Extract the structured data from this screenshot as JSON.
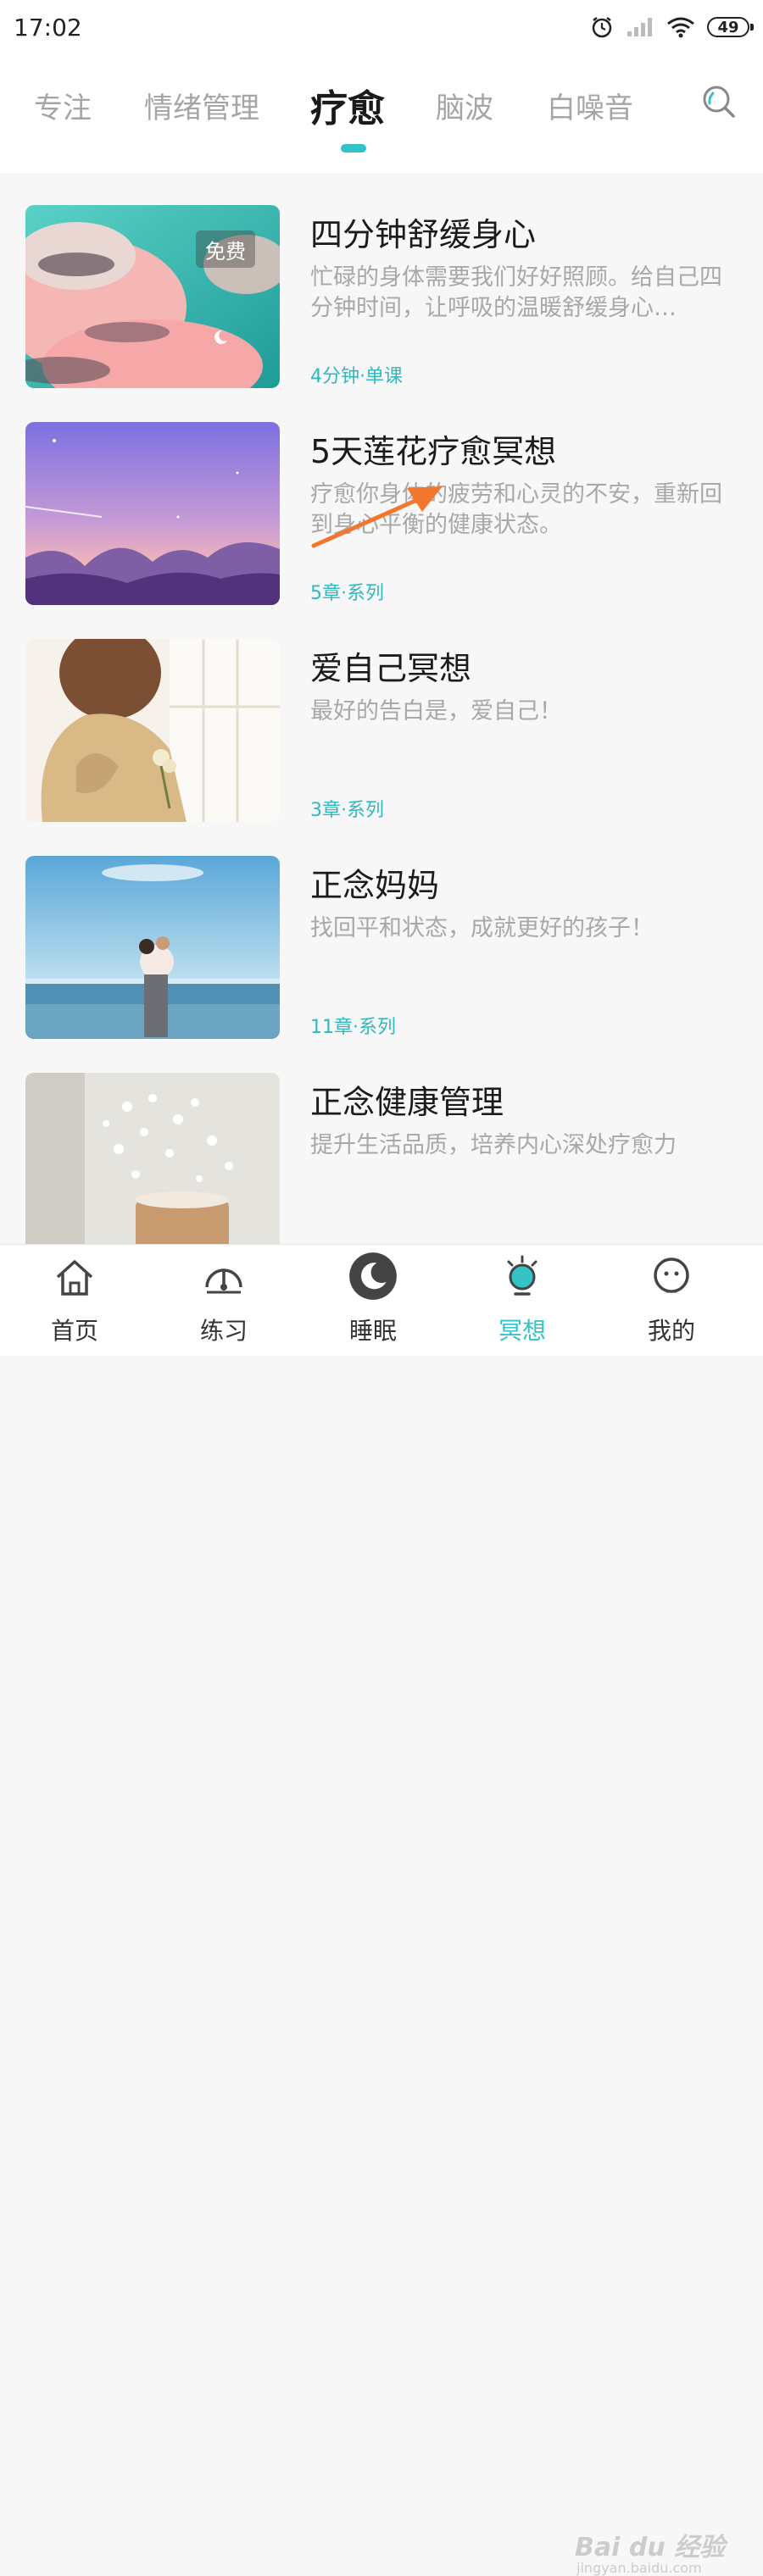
{
  "status_bar": {
    "time": "17:02",
    "battery": "49",
    "icons": [
      "alarm-icon",
      "signal-icon",
      "wifi-icon",
      "battery-icon"
    ]
  },
  "tabs": [
    {
      "label": "专注",
      "active": false
    },
    {
      "label": "情绪管理",
      "active": false
    },
    {
      "label": "疗愈",
      "active": true
    },
    {
      "label": "脑波",
      "active": false
    },
    {
      "label": "白噪音",
      "active": false
    }
  ],
  "search": {
    "icon": "search-icon"
  },
  "courses": [
    {
      "title": "四分钟舒缓身心",
      "description": "忙碌的身体需要我们好好照顾。给自己四分钟时间，让呼吸的温暖舒缓身心…",
      "meta": "4分钟·单课",
      "badge": "免费",
      "thumbnail": "pink-clouds-teal-sky"
    },
    {
      "title": "5天莲花疗愈冥想",
      "description": "疗愈你身体的疲劳和心灵的不安，重新回到身心平衡的健康状态。",
      "meta": "5章·系列",
      "thumbnail": "purple-mountain-sunset"
    },
    {
      "title": "爱自己冥想",
      "description": "最好的告白是，爱自己！",
      "meta": "3章·系列",
      "thumbnail": "woman-holding-flowers"
    },
    {
      "title": "正念妈妈",
      "description": "找回平和状态，成就更好的孩子！",
      "meta": "11章·系列",
      "thumbnail": "mother-child-beach"
    },
    {
      "title": "正念健康管理",
      "description": "提升生活品质，培养内心深处疗愈力",
      "meta": "",
      "thumbnail": "white-flowers-candle"
    }
  ],
  "bottom_nav": [
    {
      "label": "首页",
      "icon": "home-icon",
      "active": false
    },
    {
      "label": "练习",
      "icon": "gauge-icon",
      "active": false
    },
    {
      "label": "睡眠",
      "icon": "moon-icon",
      "active": false
    },
    {
      "label": "冥想",
      "icon": "bulb-icon",
      "active": true
    },
    {
      "label": "我的",
      "icon": "face-icon",
      "active": false
    }
  ],
  "colors": {
    "accent": "#33c2c5",
    "meta_text": "#2fb8bd",
    "arrow_annotation": "#f2762e"
  },
  "watermark": {
    "text": "Bai du 经验",
    "sub": "jingyan.baidu.com"
  }
}
